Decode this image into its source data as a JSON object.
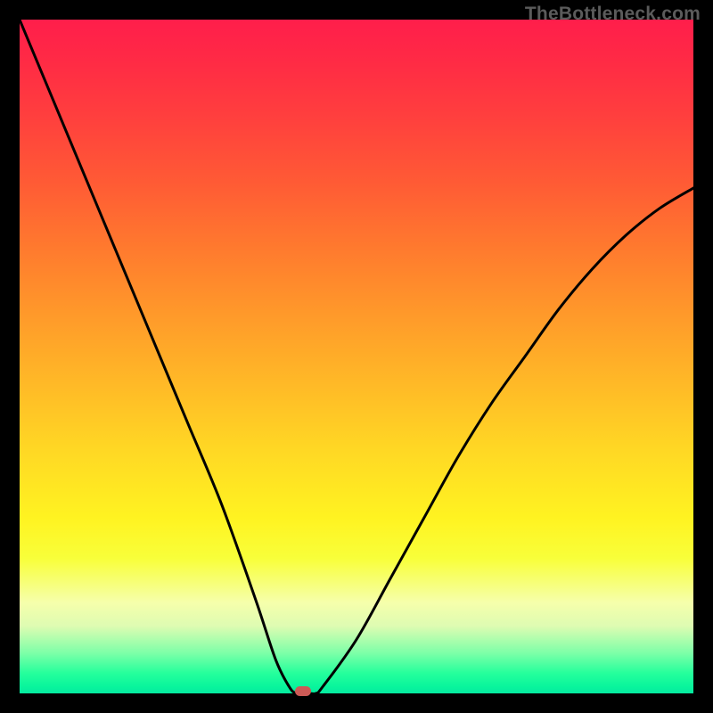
{
  "watermark": "TheBottleneck.com",
  "colors": {
    "frame_bg": "#000000",
    "curve": "#000000",
    "marker": "#cc5a56",
    "gradient_top": "#ff1e4b",
    "gradient_bottom": "#05eaa0"
  },
  "chart_data": {
    "type": "line",
    "title": "",
    "xlabel": "",
    "ylabel": "",
    "xlim": [
      0,
      100
    ],
    "ylim": [
      0,
      100
    ],
    "grid": false,
    "legend": false,
    "series": [
      {
        "name": "curve",
        "x": [
          0,
          5,
          10,
          15,
          20,
          25,
          30,
          35,
          38,
          40,
          41,
          42,
          43,
          44,
          45,
          50,
          55,
          60,
          65,
          70,
          75,
          80,
          85,
          90,
          95,
          100
        ],
        "y": [
          100,
          88,
          76,
          64,
          52,
          40,
          28,
          14,
          5,
          1,
          0,
          0,
          0,
          0,
          1,
          8,
          17,
          26,
          35,
          43,
          50,
          57,
          63,
          68,
          72,
          75
        ]
      }
    ],
    "annotations": [
      {
        "type": "marker",
        "x": 42,
        "y": 0,
        "shape": "rounded-rect",
        "color": "#cc5a56"
      }
    ],
    "background": {
      "type": "vertical-gradient",
      "stops": [
        {
          "pos": 0.0,
          "color": "#ff1e4b"
        },
        {
          "pos": 0.5,
          "color": "#ffb927"
        },
        {
          "pos": 0.8,
          "color": "#f8ff3a"
        },
        {
          "pos": 0.97,
          "color": "#25ff9c"
        },
        {
          "pos": 1.0,
          "color": "#05eaa0"
        }
      ]
    }
  }
}
